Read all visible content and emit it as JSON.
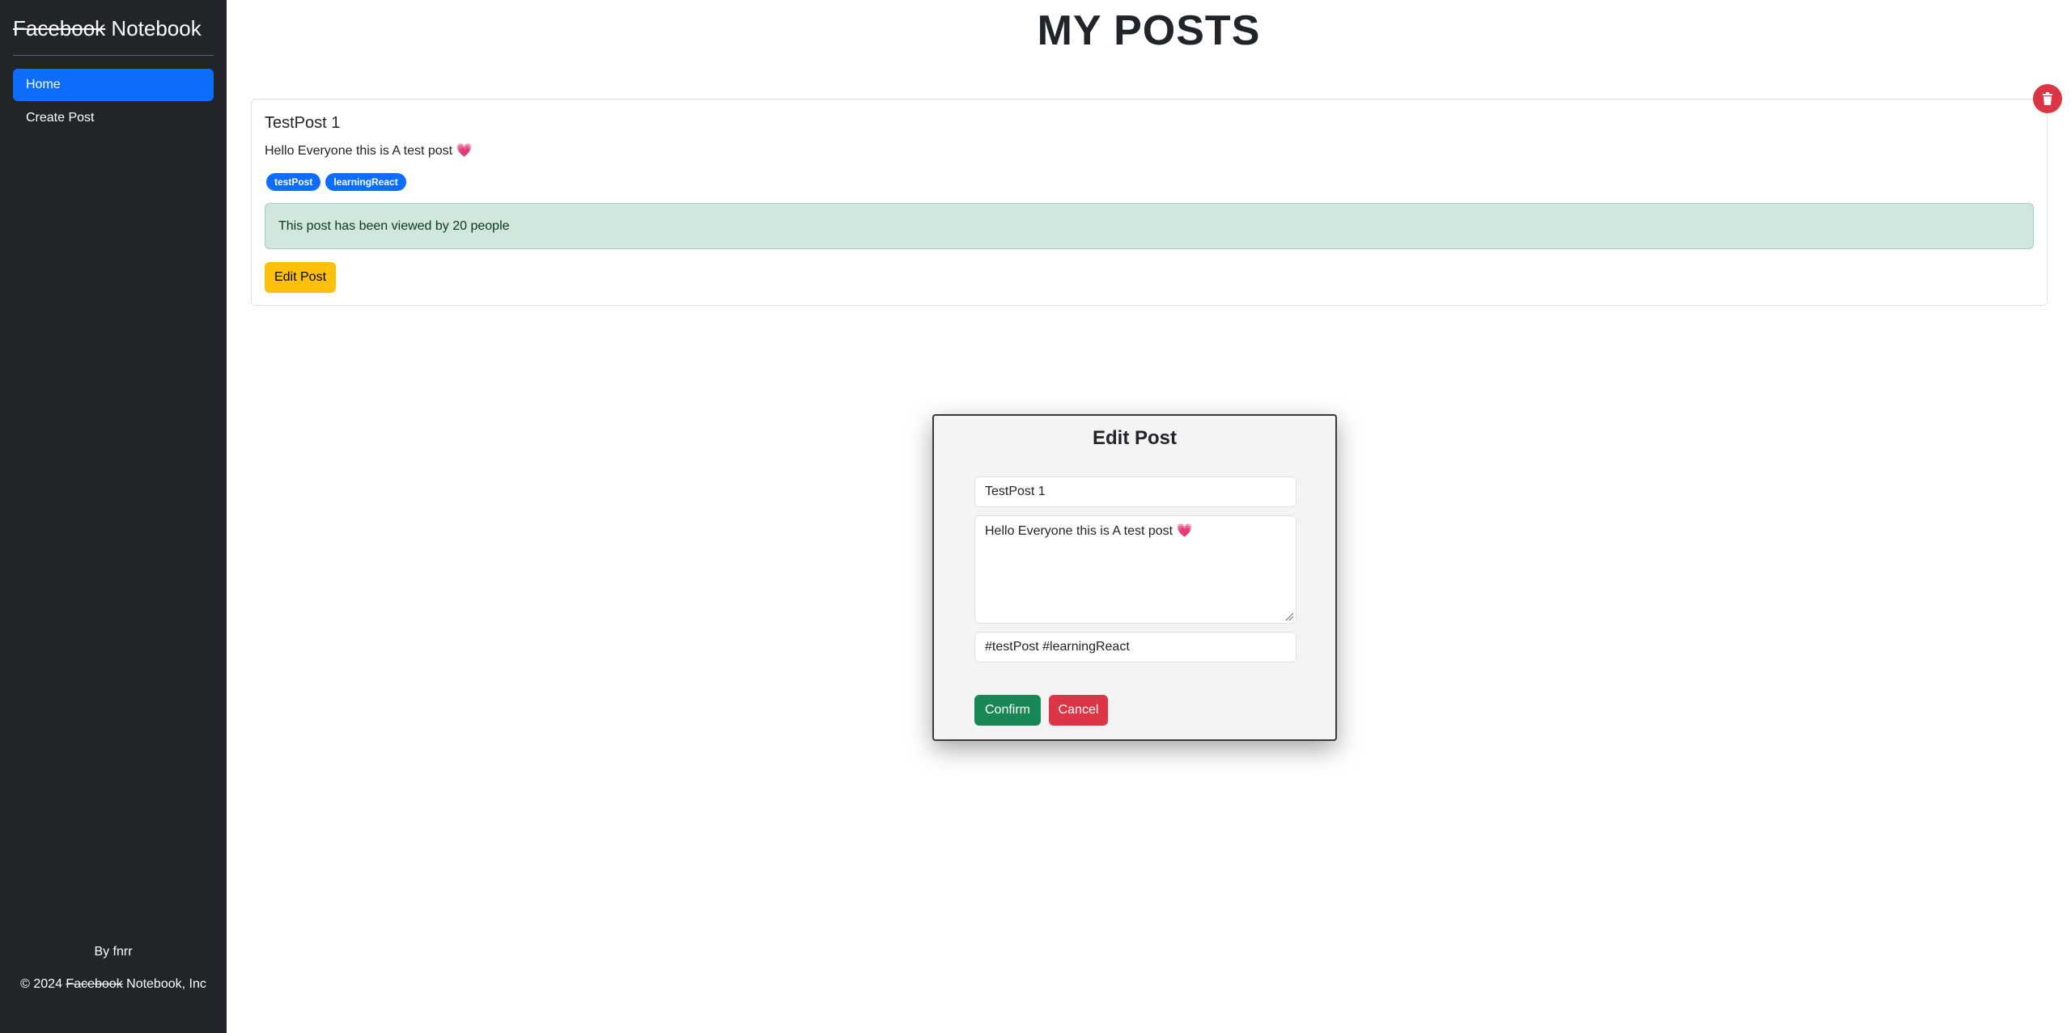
{
  "sidebar": {
    "brand_strike": "Facebook",
    "brand_rest": " Notebook",
    "items": [
      {
        "label": "Home",
        "active": true
      },
      {
        "label": "Create Post",
        "active": false
      }
    ],
    "byline": "By fnrr",
    "copyright_prefix": "© 2024 ",
    "copyright_strike": "Facebook",
    "copyright_suffix": " Notebook, Inc"
  },
  "main": {
    "page_title": "MY POSTS",
    "post": {
      "title": "TestPost 1",
      "body": "Hello Everyone this is A test post ",
      "body_emoji": "💗",
      "tags": [
        "testPost",
        "learningReact"
      ],
      "views_text": "This post has been viewed by 20 people",
      "edit_label": "Edit Post",
      "delete_icon": "trash-icon"
    }
  },
  "modal": {
    "title": "Edit Post",
    "title_value": "TestPost 1",
    "body_value": "Hello Everyone this is A test post 💗",
    "tags_value": "#testPost #learningReact",
    "confirm_label": "Confirm",
    "cancel_label": "Cancel"
  },
  "colors": {
    "sidebar_bg": "#212529",
    "primary": "#0d6efd",
    "warning": "#ffc107",
    "success": "#198754",
    "danger": "#dc3545",
    "success_bg": "#d1e7dd"
  }
}
